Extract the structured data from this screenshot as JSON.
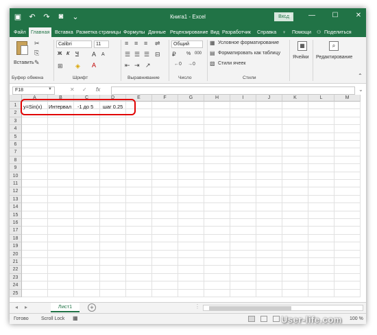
{
  "titlebar": {
    "title": "Книга1 - Excel",
    "login": "Вход"
  },
  "tabs": {
    "file": "Файл",
    "home": "Главная",
    "insert": "Вставка",
    "layout": "Разметка страницы",
    "formulas": "Формулы",
    "data": "Данные",
    "review": "Рецензирование",
    "view": "Вид",
    "developer": "Разработчик",
    "help": "Справка",
    "help_icon": "lightbulb-icon",
    "tell_me": "Помощи",
    "share": "Поделиться"
  },
  "ribbon": {
    "paste": "Вставить",
    "clipboard": "Буфер обмена",
    "font_name": "Calibri",
    "font_size": "11",
    "font_group": "Шрифт",
    "alignment_group": "Выравнивание",
    "number_format": "Общий",
    "number_group": "Число",
    "cond_format": "Условное форматирование",
    "format_table": "Форматировать как таблицу",
    "cell_styles": "Стили ячеек",
    "styles_group": "Стили",
    "cells": "Ячейки",
    "editing": "Редактирование",
    "bold": "Ж",
    "italic": "К",
    "underline": "Ч",
    "grow_font": "A",
    "shrink_font": "A",
    "percent": "%",
    "thousands": "000"
  },
  "formula_bar": {
    "cell_ref": "F18",
    "cancel": "✕",
    "confirm": "✓",
    "fx": "fx",
    "value": ""
  },
  "columns": [
    "A",
    "B",
    "C",
    "D",
    "E",
    "F",
    "G",
    "H",
    "I",
    "J",
    "K",
    "L",
    "M"
  ],
  "rows": [
    "1",
    "2",
    "3",
    "4",
    "5",
    "6",
    "7",
    "8",
    "9",
    "10",
    "11",
    "12",
    "13",
    "14",
    "15",
    "16",
    "17",
    "18",
    "19",
    "20",
    "21",
    "22",
    "23",
    "24",
    "25"
  ],
  "cells": {
    "a1": "y=Sin(x)",
    "b1": "Интервал",
    "c1": "-1 до 5",
    "d1": "шаг 0.25"
  },
  "sheets": {
    "active": "Лист1",
    "add": "+"
  },
  "status": {
    "ready": "Готово",
    "scroll_lock": "Scroll Lock",
    "zoom": "100 %"
  },
  "watermark": "User-life.com",
  "colors": {
    "accent": "#217346",
    "highlight": "#e00000"
  }
}
